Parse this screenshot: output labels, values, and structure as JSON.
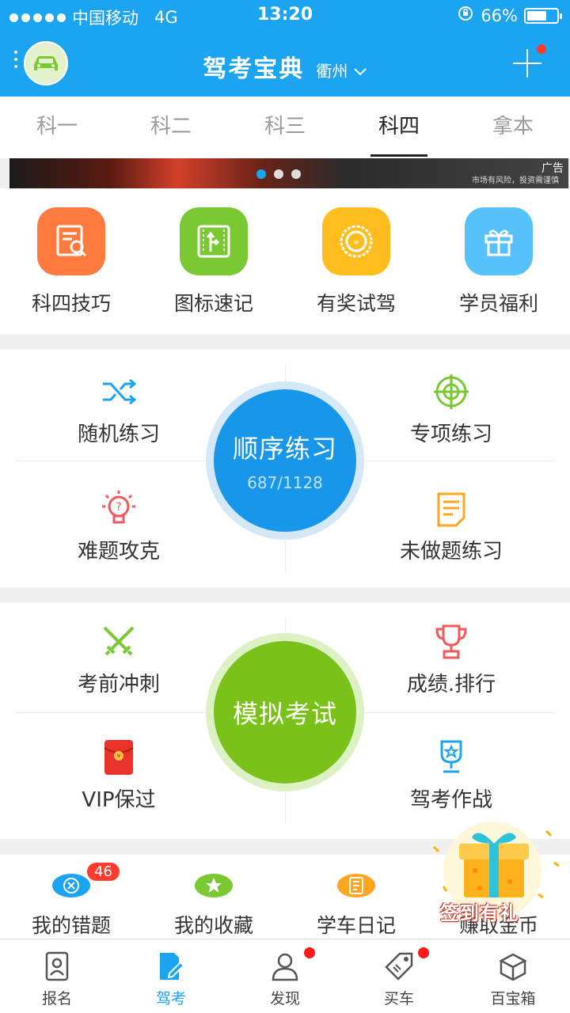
{
  "status": {
    "carrier": "中国移动",
    "network": "4G",
    "time": "13:20",
    "battery_text": "66%",
    "battery_level": 0.66
  },
  "header": {
    "title": "驾考宝典",
    "city": "衢州",
    "has_notification": true
  },
  "subject_tabs": [
    {
      "label": "科一",
      "active": false
    },
    {
      "label": "科二",
      "active": false
    },
    {
      "label": "科三",
      "active": false
    },
    {
      "label": "科四",
      "active": true
    },
    {
      "label": "拿本",
      "active": false
    }
  ],
  "banner": {
    "ad_label": "广告",
    "note": "市场有风险，投资需谨慎"
  },
  "quick_items": [
    {
      "label": "科四技巧",
      "color": "#ff7a3d",
      "icon": "magnify-doc-icon"
    },
    {
      "label": "图标速记",
      "color": "#7ac832",
      "icon": "road-sign-icon"
    },
    {
      "label": "有奖试驾",
      "color": "#ffbe1e",
      "icon": "steering-wheel-icon"
    },
    {
      "label": "学员福利",
      "color": "#56c2f9",
      "icon": "gift-icon"
    }
  ],
  "practice": {
    "random": "随机练习",
    "special": "专项练习",
    "sequence": "顺序练习",
    "sequence_progress": "687/1128",
    "difficult": "难题攻克",
    "undone": "未做题练习"
  },
  "exam": {
    "sprint": "考前冲刺",
    "ranking": "成绩.排行",
    "mock": "模拟考试",
    "vip": "VIP保过",
    "battle": "驾考作战"
  },
  "bottom_items": [
    {
      "label": "我的错题",
      "color": "#1ba4f0",
      "badge": "46"
    },
    {
      "label": "我的收藏",
      "color": "#7ac832",
      "badge": ""
    },
    {
      "label": "学车日记",
      "color": "#ffa51e",
      "badge": ""
    }
  ],
  "gift": {
    "label": "签到有礼",
    "partial_label": "赚取金币"
  },
  "tabbar": [
    {
      "label": "报名",
      "active": false,
      "dot": false
    },
    {
      "label": "驾考",
      "active": true,
      "dot": false
    },
    {
      "label": "发现",
      "active": false,
      "dot": true
    },
    {
      "label": "买车",
      "active": false,
      "dot": true
    },
    {
      "label": "百宝箱",
      "active": false,
      "dot": false
    }
  ],
  "colors": {
    "primary": "#1ba4f0",
    "green": "#7ac832",
    "red_dot": "#ff1a1a"
  }
}
